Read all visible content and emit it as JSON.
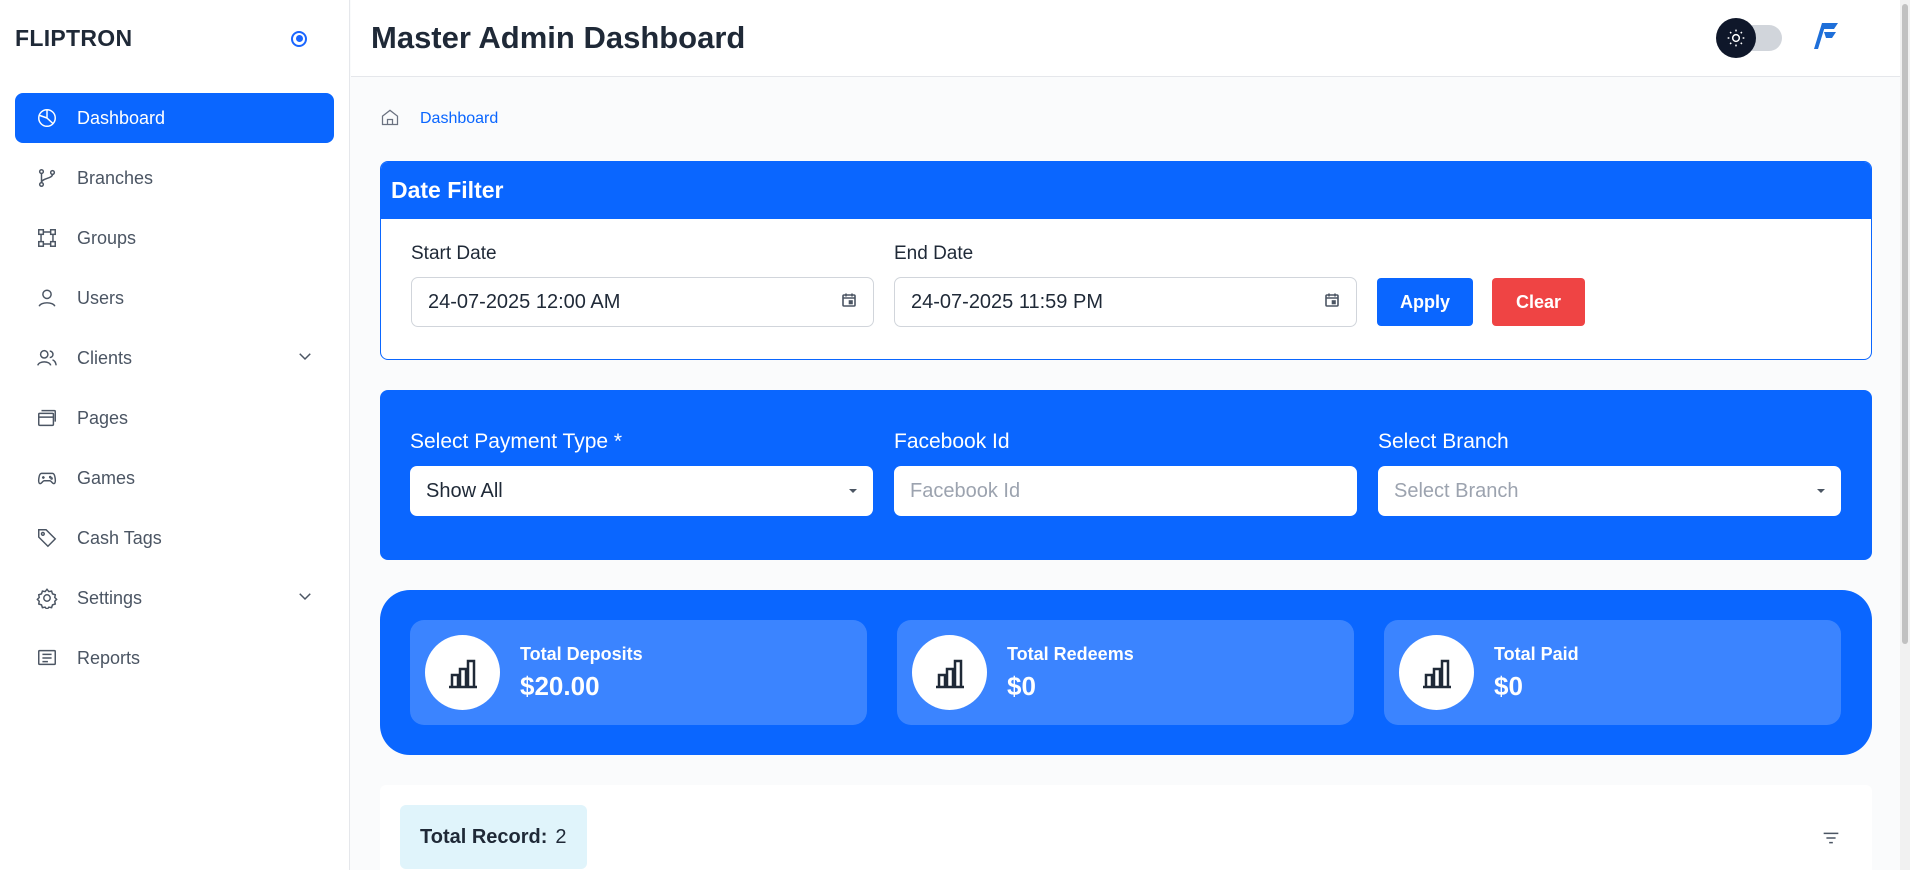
{
  "brand": {
    "name": "FLIPTRON"
  },
  "sidebar": {
    "items": [
      {
        "label": "Dashboard",
        "icon": "pie-chart-icon",
        "active": true
      },
      {
        "label": "Branches",
        "icon": "git-branch-icon"
      },
      {
        "label": "Groups",
        "icon": "group-icon"
      },
      {
        "label": "Users",
        "icon": "user-icon"
      },
      {
        "label": "Clients",
        "icon": "users-icon",
        "has_children": true
      },
      {
        "label": "Pages",
        "icon": "pages-icon"
      },
      {
        "label": "Games",
        "icon": "gamepad-icon"
      },
      {
        "label": "Cash Tags",
        "icon": "tag-icon"
      },
      {
        "label": "Settings",
        "icon": "gear-icon",
        "has_children": true
      },
      {
        "label": "Reports",
        "icon": "report-icon"
      }
    ]
  },
  "header": {
    "title": "Master Admin Dashboard"
  },
  "breadcrumb": {
    "current": "Dashboard"
  },
  "date_filter": {
    "title": "Date Filter",
    "start_label": "Start Date",
    "start_value": "24-07-2025 12:00 AM",
    "end_label": "End Date",
    "end_value": "24-07-2025 11:59 PM",
    "apply_label": "Apply",
    "clear_label": "Clear"
  },
  "selects": {
    "payment_type_label": "Select Payment Type *",
    "payment_type_value": "Show All",
    "facebook_label": "Facebook Id",
    "facebook_placeholder": "Facebook Id",
    "branch_label": "Select Branch",
    "branch_placeholder": "Select Branch"
  },
  "stats": [
    {
      "label": "Total Deposits",
      "value": "$20.00"
    },
    {
      "label": "Total Redeems",
      "value": "$0"
    },
    {
      "label": "Total Paid",
      "value": "$0"
    }
  ],
  "records": {
    "label": "Total Record:",
    "count": "2"
  },
  "colors": {
    "primary": "#0a66ff",
    "danger": "#ef4444",
    "info_bg": "#e0f4fb"
  }
}
